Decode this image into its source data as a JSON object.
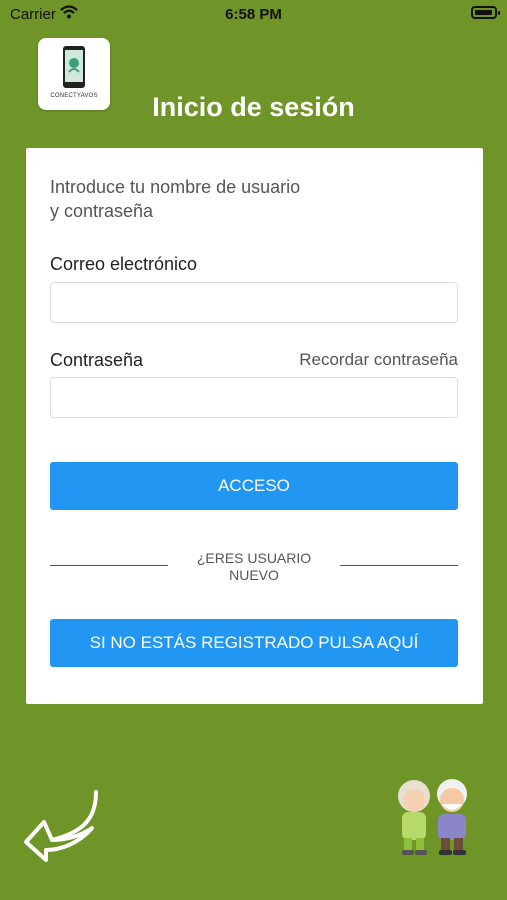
{
  "status_bar": {
    "carrier": "Carrier",
    "time": "6:58 PM"
  },
  "logo": {
    "caption": "CONECTYAVOS"
  },
  "header": {
    "title": "Inicio de sesión"
  },
  "form": {
    "intro_line1": "Introduce tu nombre de usuario",
    "intro_line2": "y contraseña",
    "email_label": "Correo electrónico",
    "email_value": "",
    "password_label": "Contraseña",
    "password_value": "",
    "remember_link": "Recordar contraseña",
    "submit_label": "ACCESO",
    "new_user_line1": "¿ERES USUARIO",
    "new_user_line2": "NUEVO",
    "register_label": "SI NO ESTÁS REGISTRADO PULSA AQUÍ"
  },
  "colors": {
    "background": "#6f9428",
    "primary": "#2196f3",
    "card": "#ffffff"
  },
  "icons": {
    "wifi": "wifi-icon",
    "battery": "battery-icon",
    "logo": "phone-logo-icon",
    "back": "back-arrow-icon",
    "illustration": "elderly-couple-icon"
  }
}
